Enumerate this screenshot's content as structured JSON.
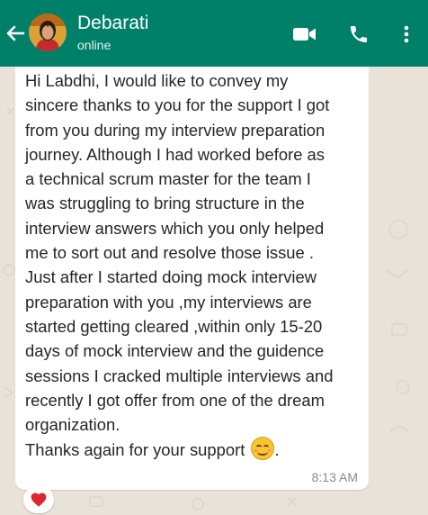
{
  "header": {
    "contact_name": "Debarati",
    "status": "online",
    "icons": [
      "back-arrow-icon",
      "video-call-icon",
      "phone-icon",
      "more-vert-icon"
    ],
    "background_color": "#008069"
  },
  "message": {
    "lines": [
      "Hi Labdhi, I would like to convey my",
      "sincere thanks to you for the support I got",
      "from you during my interview preparation",
      "journey. Although I had worked before as",
      "a technical scrum master for the team I",
      "was struggling to bring structure in the",
      "interview answers which you only helped",
      "me to sort out and resolve those issue .",
      "Just after I started doing mock interview",
      "preparation with you ,my interviews are",
      "started getting cleared ,within only 15-20",
      "days of mock interview and the guidence",
      "sessions I cracked multiple interviews and",
      "recently I got offer from one of the dream",
      "organization.",
      "Thanks again for your support"
    ],
    "emoji": "smiling-face-icon",
    "closing_punctuation": ".",
    "time": "8:13 AM"
  },
  "reaction": {
    "emoji": "heart-icon",
    "color": "#e0262c"
  }
}
